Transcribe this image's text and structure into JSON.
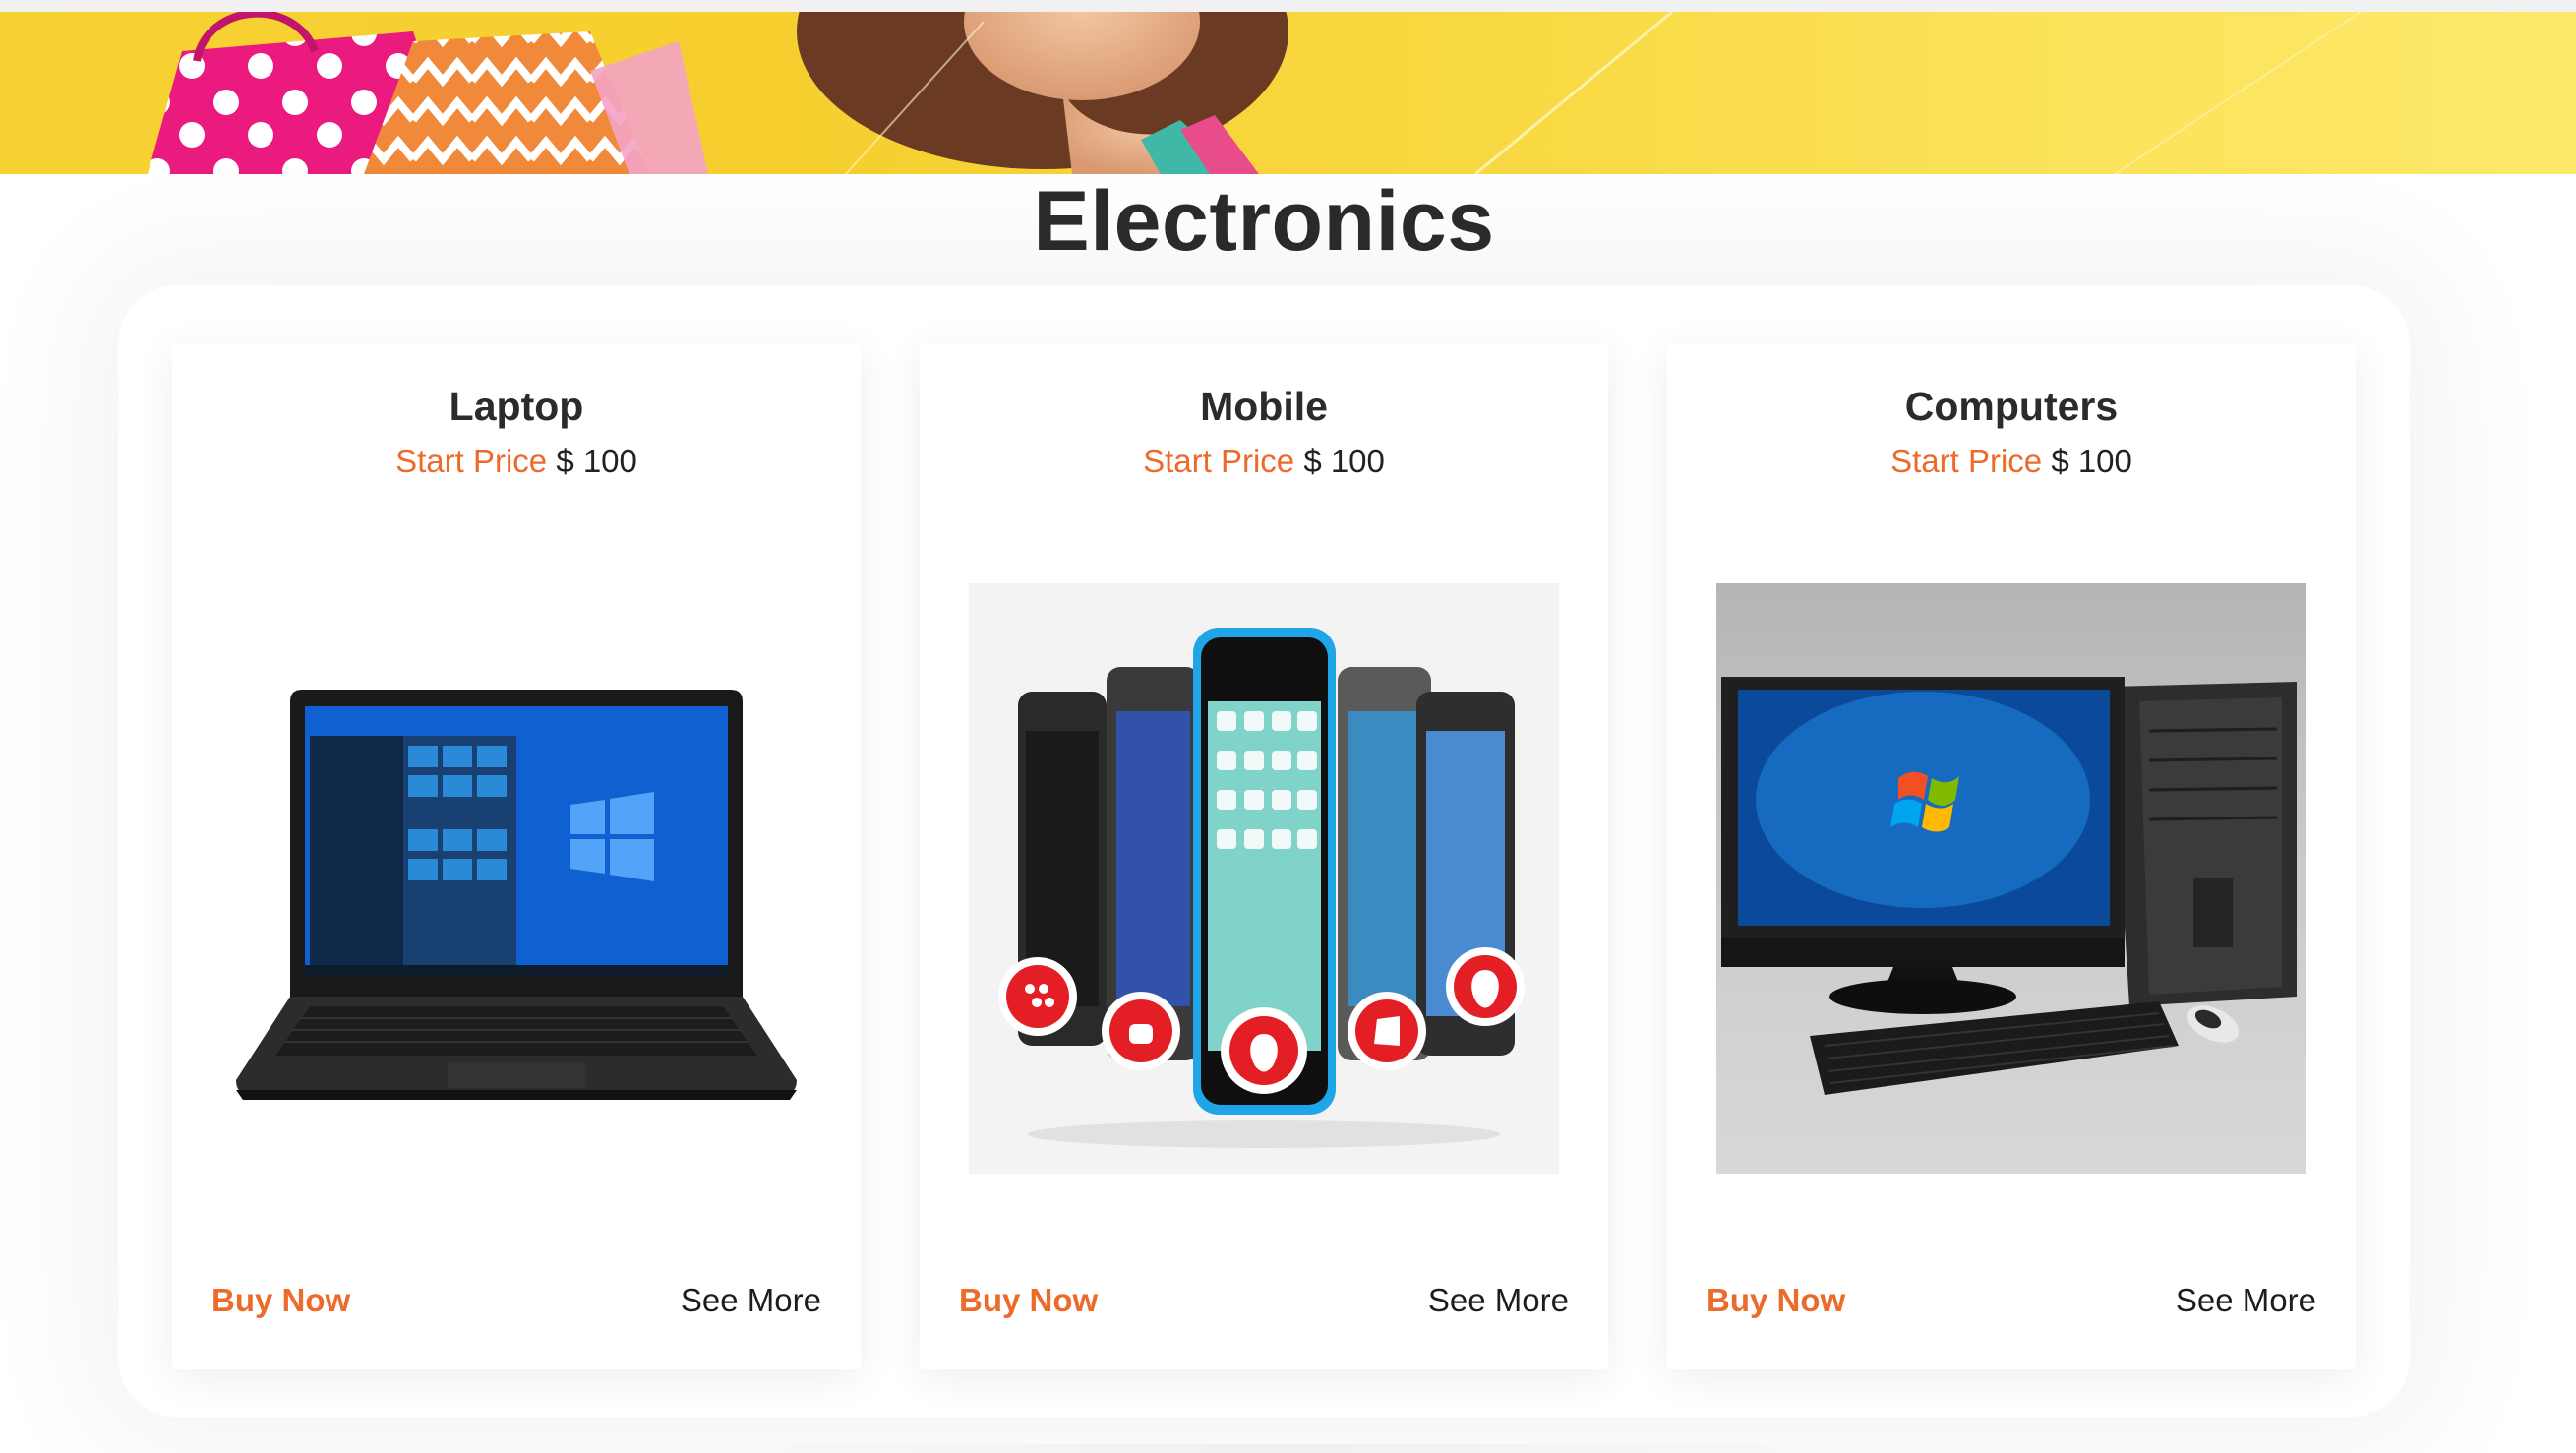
{
  "section": {
    "title": "Electronics"
  },
  "colors": {
    "accent": "#ec6a2a",
    "text": "#2b2b2b",
    "banner": "#f7d233"
  },
  "cards": [
    {
      "title": "Laptop",
      "price_label": "Start Price",
      "price_value": "$ 100",
      "buy_label": "Buy Now",
      "more_label": "See More",
      "image_icon": "laptop-icon"
    },
    {
      "title": "Mobile",
      "price_label": "Start Price",
      "price_value": "$ 100",
      "buy_label": "Buy Now",
      "more_label": "See More",
      "image_icon": "smartphones-icon"
    },
    {
      "title": "Computers",
      "price_label": "Start Price",
      "price_value": "$ 100",
      "buy_label": "Buy Now",
      "more_label": "See More",
      "image_icon": "desktop-computer-icon"
    }
  ]
}
